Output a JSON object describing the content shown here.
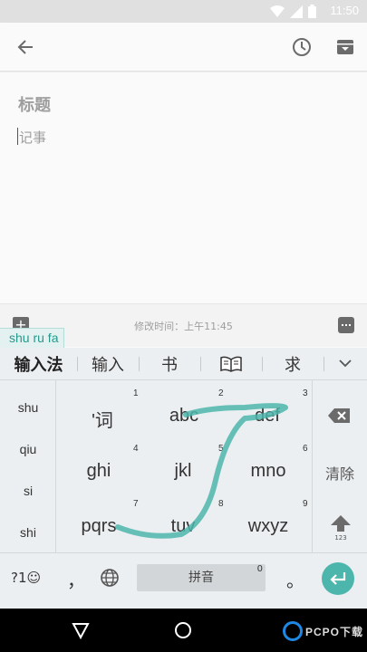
{
  "status_bar": {
    "time": "11:50",
    "icons": [
      "wifi-icon",
      "signal-icon",
      "battery-icon"
    ]
  },
  "app_bar": {
    "back_icon": "arrow-left-icon",
    "reminder_icon": "clock-icon",
    "archive_icon": "archive-icon"
  },
  "note": {
    "title_placeholder": "标题",
    "body_placeholder": "记事"
  },
  "note_bar": {
    "edited_time": "修改时间：上午11:45"
  },
  "ime": {
    "composing_text": "shu ru fa",
    "candidates": [
      "输入法",
      "输入",
      "书",
      "📖",
      "求"
    ],
    "left_column": [
      "shu",
      "qiu",
      "si",
      "shi"
    ],
    "keys": [
      {
        "label": "'词",
        "number": "1"
      },
      {
        "label": "abc",
        "number": "2"
      },
      {
        "label": "def",
        "number": "3"
      },
      {
        "label": "ghi",
        "number": "4"
      },
      {
        "label": "jkl",
        "number": "5"
      },
      {
        "label": "mno",
        "number": "6"
      },
      {
        "label": "pqrs",
        "number": "7"
      },
      {
        "label": "tuv",
        "number": "8"
      },
      {
        "label": "wxyz",
        "number": "9"
      }
    ],
    "clear_label": "清除",
    "shift_sub_label": "123",
    "symbol_key": "?1☺",
    "comma_key": "，",
    "space_label": "拼音",
    "space_number": "0",
    "period_key": "。",
    "accent_color": "#4db6ac"
  },
  "nav_bar": {
    "watermark": "PCPO下载"
  }
}
